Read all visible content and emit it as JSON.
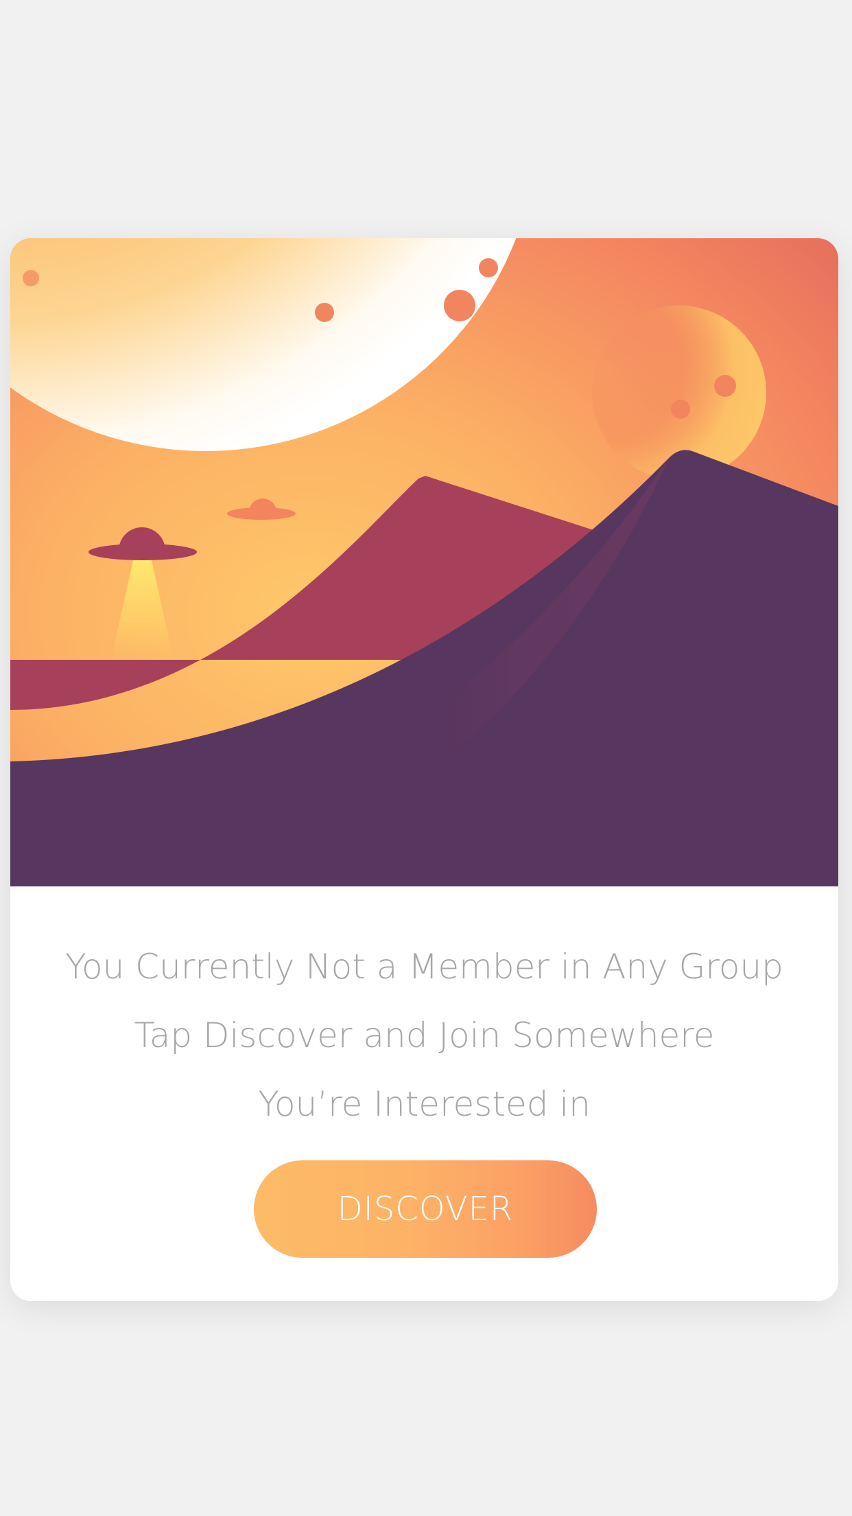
{
  "empty_state": {
    "message_lines": [
      "You Currently Not a Member in Any Group",
      "Tap Discover and Join Somewhere",
      "You’re Interested in"
    ],
    "discover_label": "DISCOVER"
  },
  "colors": {
    "page_background": "#f1f1f1",
    "card_background": "#ffffff",
    "sky_light": "#fdc268",
    "sky_dark": "#e1665a",
    "dune_front": "#57365f",
    "dune_back": "#a7405a",
    "text": "#a6a6a6",
    "button_start": "#fdbb67",
    "button_end": "#f68b60"
  },
  "icons": [
    "ufo-icon",
    "ufo-icon",
    "planet-icon",
    "moon-icon"
  ]
}
